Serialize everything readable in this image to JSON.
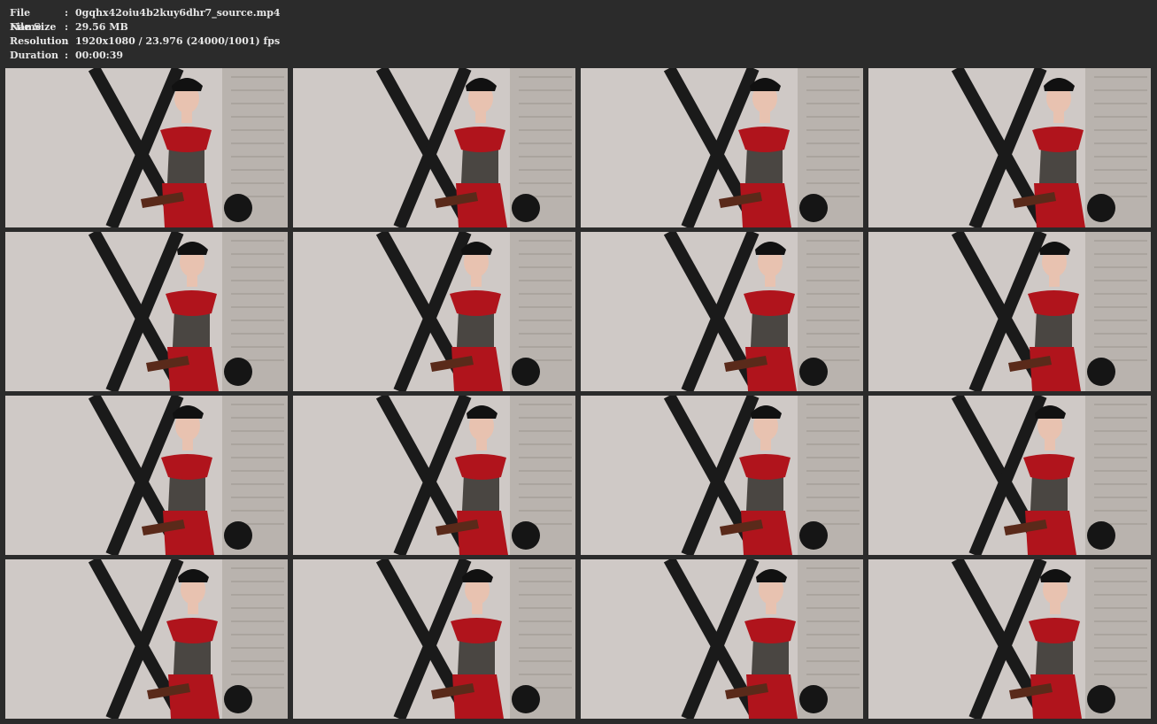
{
  "file_info": {
    "rows": [
      {
        "label": "File Name",
        "value": "0gqhx42oiu4b2kuy6dhr7_source.mp4"
      },
      {
        "label": "File Size",
        "value": "29.56 MB"
      },
      {
        "label": "Resolution",
        "value": "1920x1080 / 23.976 (24000/1001) fps"
      },
      {
        "label": "Duration",
        "value": "00:00:39"
      }
    ]
  },
  "contact_sheet": {
    "columns": 4,
    "rows": 4,
    "thumbnail_count": 16,
    "colors": {
      "background": "#2b2b2b",
      "wall": "#cfc9c6",
      "latex_red": "#b0141c",
      "cross_black": "#1a1a1a"
    }
  }
}
